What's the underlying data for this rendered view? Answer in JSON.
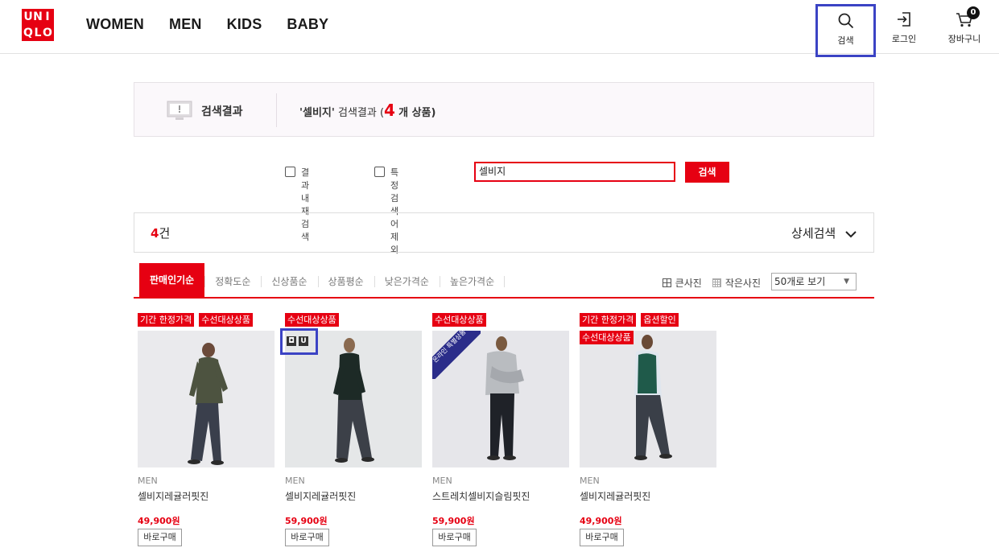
{
  "header": {
    "logo_letters": [
      "U",
      "N",
      "I",
      "Q",
      "L",
      "O"
    ],
    "nav": [
      "WOMEN",
      "MEN",
      "KIDS",
      "BABY"
    ],
    "search_label": "검색",
    "login_label": "로그인",
    "cart_label": "장바구니",
    "cart_count": "0"
  },
  "banner": {
    "title": "검색결과",
    "query_quoted": "'셀비지'",
    "result_text": "검색결과 (",
    "count": "4",
    "suffix": "개 상품)"
  },
  "search": {
    "within_label": "결과 내 재 검색",
    "exclude_label": "특정검색어 제외",
    "value": "셀비지",
    "button": "검색"
  },
  "count_bar": {
    "count": "4",
    "unit": "건",
    "advanced": "상세검색"
  },
  "sort": {
    "tabs": [
      "판매인기순",
      "정확도순",
      "신상품순",
      "상품평순",
      "낮은가격순",
      "높은가격순"
    ],
    "large_view": "큰사진",
    "small_view": "작은사진",
    "per_page": "50개로 보기"
  },
  "products": [
    {
      "tags": [
        "기간 한정가격",
        "수선대상상품"
      ],
      "gender": "MEN",
      "name": "셀비지레귤러핏진",
      "price": "49,900원",
      "buy": "바로구매"
    },
    {
      "tags": [
        "수선대상상품"
      ],
      "gender": "MEN",
      "name": "셀비지레귤러핏진",
      "price": "59,900원",
      "buy": "바로구매"
    },
    {
      "tags": [
        "수선대상상품"
      ],
      "gender": "MEN",
      "name": "스트레치셀비지슬림핏진",
      "price": "59,900원",
      "buy": "바로구매",
      "ribbon": "온라인 특별상품"
    },
    {
      "tags": [
        "기간 한정가격",
        "옵션할인",
        "수선대상상품"
      ],
      "gender": "MEN",
      "name": "셀비지레귤러핏진",
      "price": "49,900원",
      "buy": "바로구매"
    }
  ]
}
